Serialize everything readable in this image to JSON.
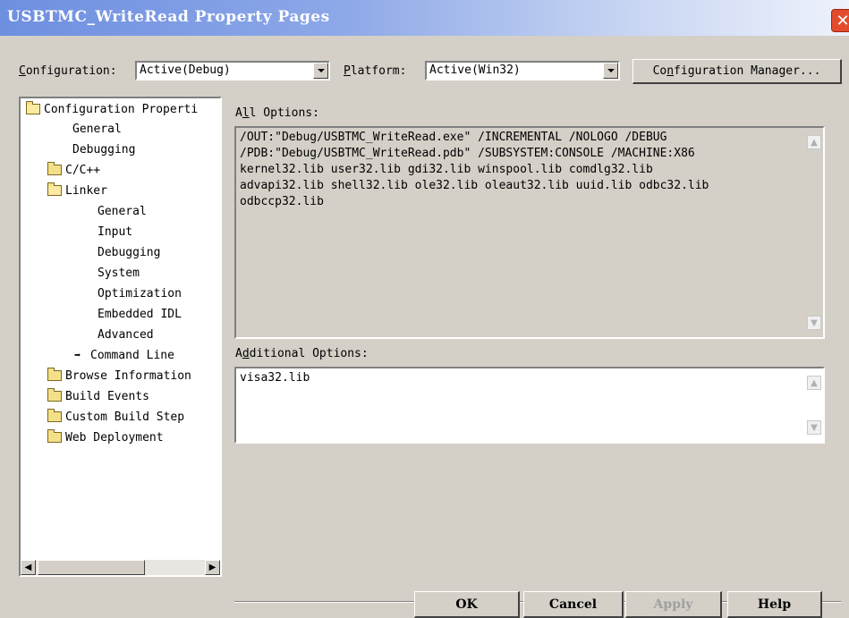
{
  "window": {
    "title": "USBTMC_WriteRead Property Pages",
    "close_glyph": "✕"
  },
  "toolbar": {
    "configuration_label": "Configuration:",
    "configuration_value": "Active(Debug)",
    "platform_label": "Platform:",
    "platform_value": "Active(Win32)",
    "config_manager_label": "Configuration Manager..."
  },
  "tree": {
    "root": "Configuration Properti",
    "items": {
      "general": "General",
      "debugging": "Debugging",
      "cpp": "C/C++",
      "linker": "Linker",
      "linker_general": "General",
      "linker_input": "Input",
      "linker_debugging": "Debugging",
      "linker_system": "System",
      "linker_optimization": "Optimization",
      "linker_embedded_idl": "Embedded IDL",
      "linker_advanced": "Advanced",
      "linker_command_line": "Command Line",
      "browse_information": "Browse Information",
      "build_events": "Build Events",
      "custom_build_step": "Custom Build Step",
      "web_deployment": "Web Deployment"
    },
    "selected": "Command Line"
  },
  "all_options": {
    "label": "All Options:",
    "text": "/OUT:\"Debug/USBTMC_WriteRead.exe\" /INCREMENTAL /NOLOGO /DEBUG\n/PDB:\"Debug/USBTMC_WriteRead.pdb\" /SUBSYSTEM:CONSOLE /MACHINE:X86\nkernel32.lib user32.lib gdi32.lib winspool.lib comdlg32.lib\nadvapi32.lib shell32.lib ole32.lib oleaut32.lib uuid.lib odbc32.lib\nodbccp32.lib"
  },
  "additional_options": {
    "label": "Additional Options:",
    "text": "visa32.lib"
  },
  "buttons": {
    "ok": "OK",
    "cancel": "Cancel",
    "apply": "Apply",
    "help": "Help"
  }
}
